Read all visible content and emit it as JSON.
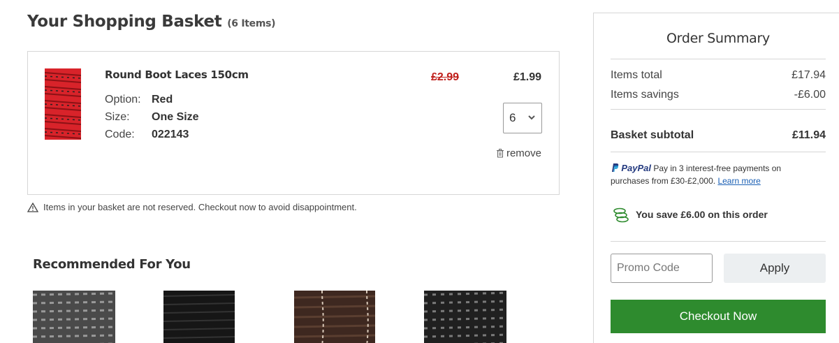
{
  "basket": {
    "title": "Your Shopping Basket",
    "count_label": "(6 Items)"
  },
  "item": {
    "name": "Round Boot Laces 150cm",
    "attributes": [
      {
        "label": "Option:",
        "value": "Red"
      },
      {
        "label": "Size:",
        "value": "One Size"
      },
      {
        "label": "Code:",
        "value": "022143"
      }
    ],
    "old_price": "£2.99",
    "price": "£1.99",
    "quantity": "6",
    "remove_label": "remove",
    "image_color": "#d8232a"
  },
  "notice": "Items in your basket are not reserved. Checkout now to avoid disappointment.",
  "recommended": {
    "title": "Recommended For You",
    "items": [
      {
        "icon": "lace-grey-image",
        "color": "#555555"
      },
      {
        "icon": "lace-black-image",
        "color": "#1a1a1a"
      },
      {
        "icon": "lace-brown-image",
        "color": "#4a3024"
      },
      {
        "icon": "lace-black-grey-image",
        "color": "#2a2a2a"
      }
    ]
  },
  "summary": {
    "title": "Order Summary",
    "items_total_label": "Items total",
    "items_total_value": "£17.94",
    "savings_label": "Items savings",
    "savings_value": "-£6.00",
    "subtotal_label": "Basket subtotal",
    "subtotal_value": "£11.94",
    "paypal_brand": "PayPal",
    "paypal_text": "Pay in 3 interest-free payments on purchases from £30-£2,000.",
    "paypal_link": "Learn more",
    "save_text": "You save £6.00 on this order",
    "promo_placeholder": "Promo Code",
    "apply_label": "Apply",
    "checkout_label": "Checkout Now"
  },
  "colors": {
    "sale_red": "#c0201c",
    "checkout_green": "#2e8b2e",
    "paypal_blue": "#253b80"
  }
}
